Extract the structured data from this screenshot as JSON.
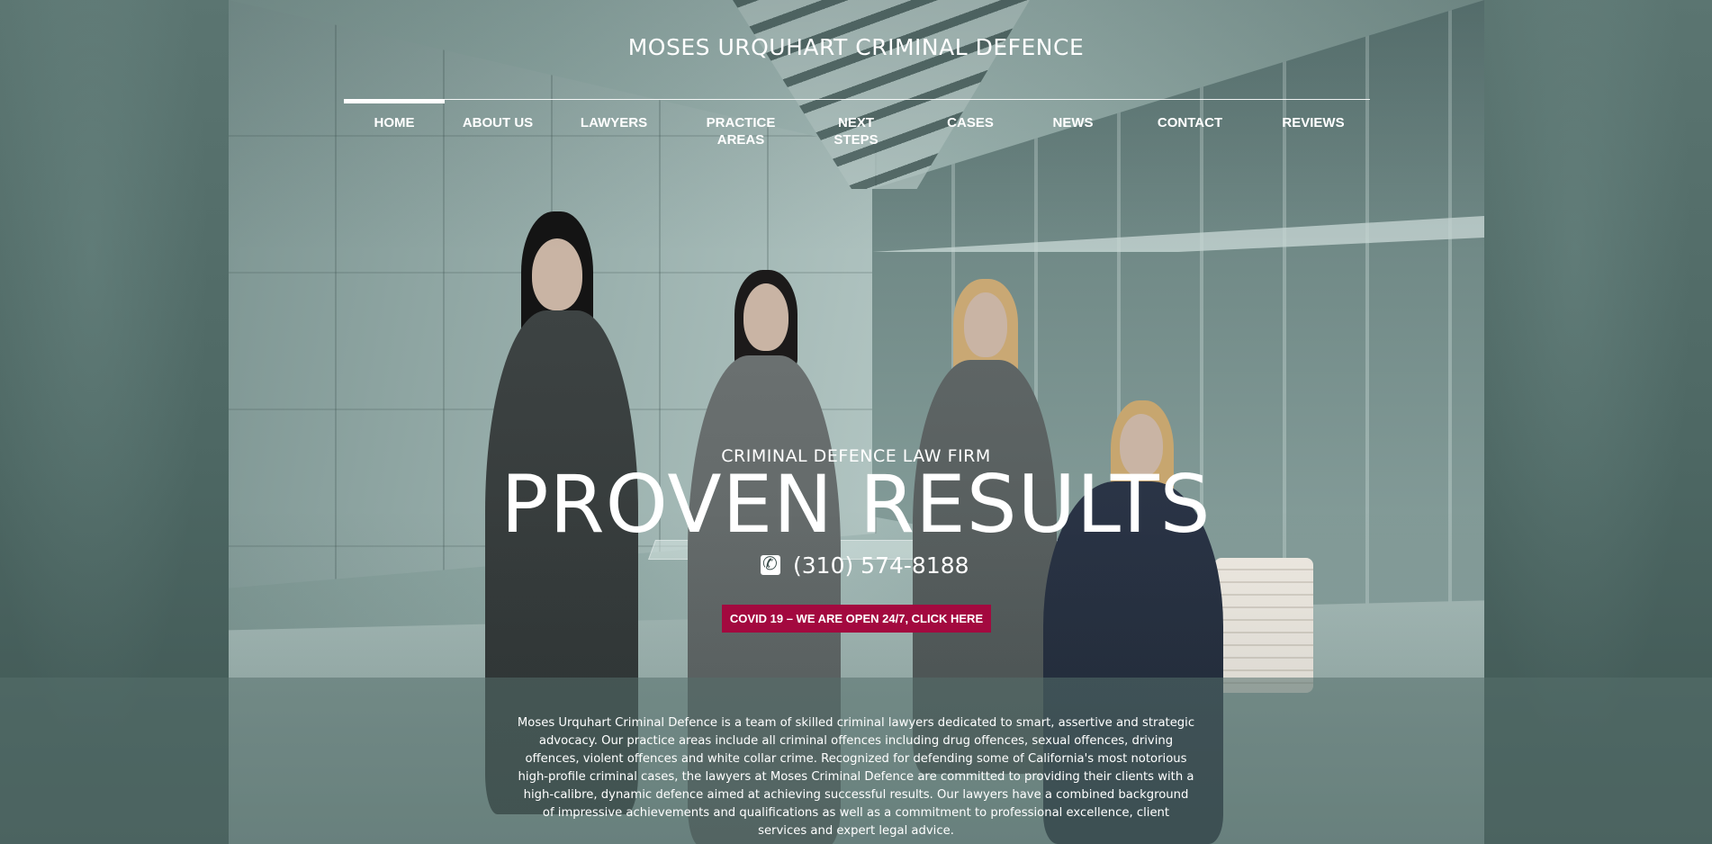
{
  "site": {
    "title": "MOSES URQUHART CRIMINAL DEFENCE"
  },
  "nav": {
    "items": [
      {
        "label": "HOME",
        "active": true
      },
      {
        "label": "ABOUT US"
      },
      {
        "label": "LAWYERS"
      },
      {
        "label": "PRACTICE AREAS"
      },
      {
        "label": "NEXT STEPS"
      },
      {
        "label": "CASES"
      },
      {
        "label": "NEWS"
      },
      {
        "label": "CONTACT"
      },
      {
        "label": "REVIEWS"
      }
    ]
  },
  "hero": {
    "kicker": "CRIMINAL DEFENCE LAW FIRM",
    "headline": "PROVEN RESULTS",
    "phone": "(310) 574-8188",
    "phone_icon": "phone-icon",
    "cta": "COVID 19 – WE ARE OPEN 24/7, CLICK HERE",
    "cta_color": "#a3093f"
  },
  "intro": {
    "text": "Moses Urquhart Criminal Defence is a team of skilled criminal lawyers dedicated to smart, assertive and strategic advocacy.  Our practice areas include all criminal offences including drug offences, sexual offences, driving offences, violent offences and white collar crime.  Recognized for defending some of California's most notorious high-profile criminal cases, the lawyers at Moses Criminal Defence are committed to providing their clients with a high-calibre, dynamic defence aimed at achieving successful results.  Our lawyers have a combined background of impressive achievements and qualifications as well as a commitment to professional excellence, client services and expert legal advice."
  }
}
